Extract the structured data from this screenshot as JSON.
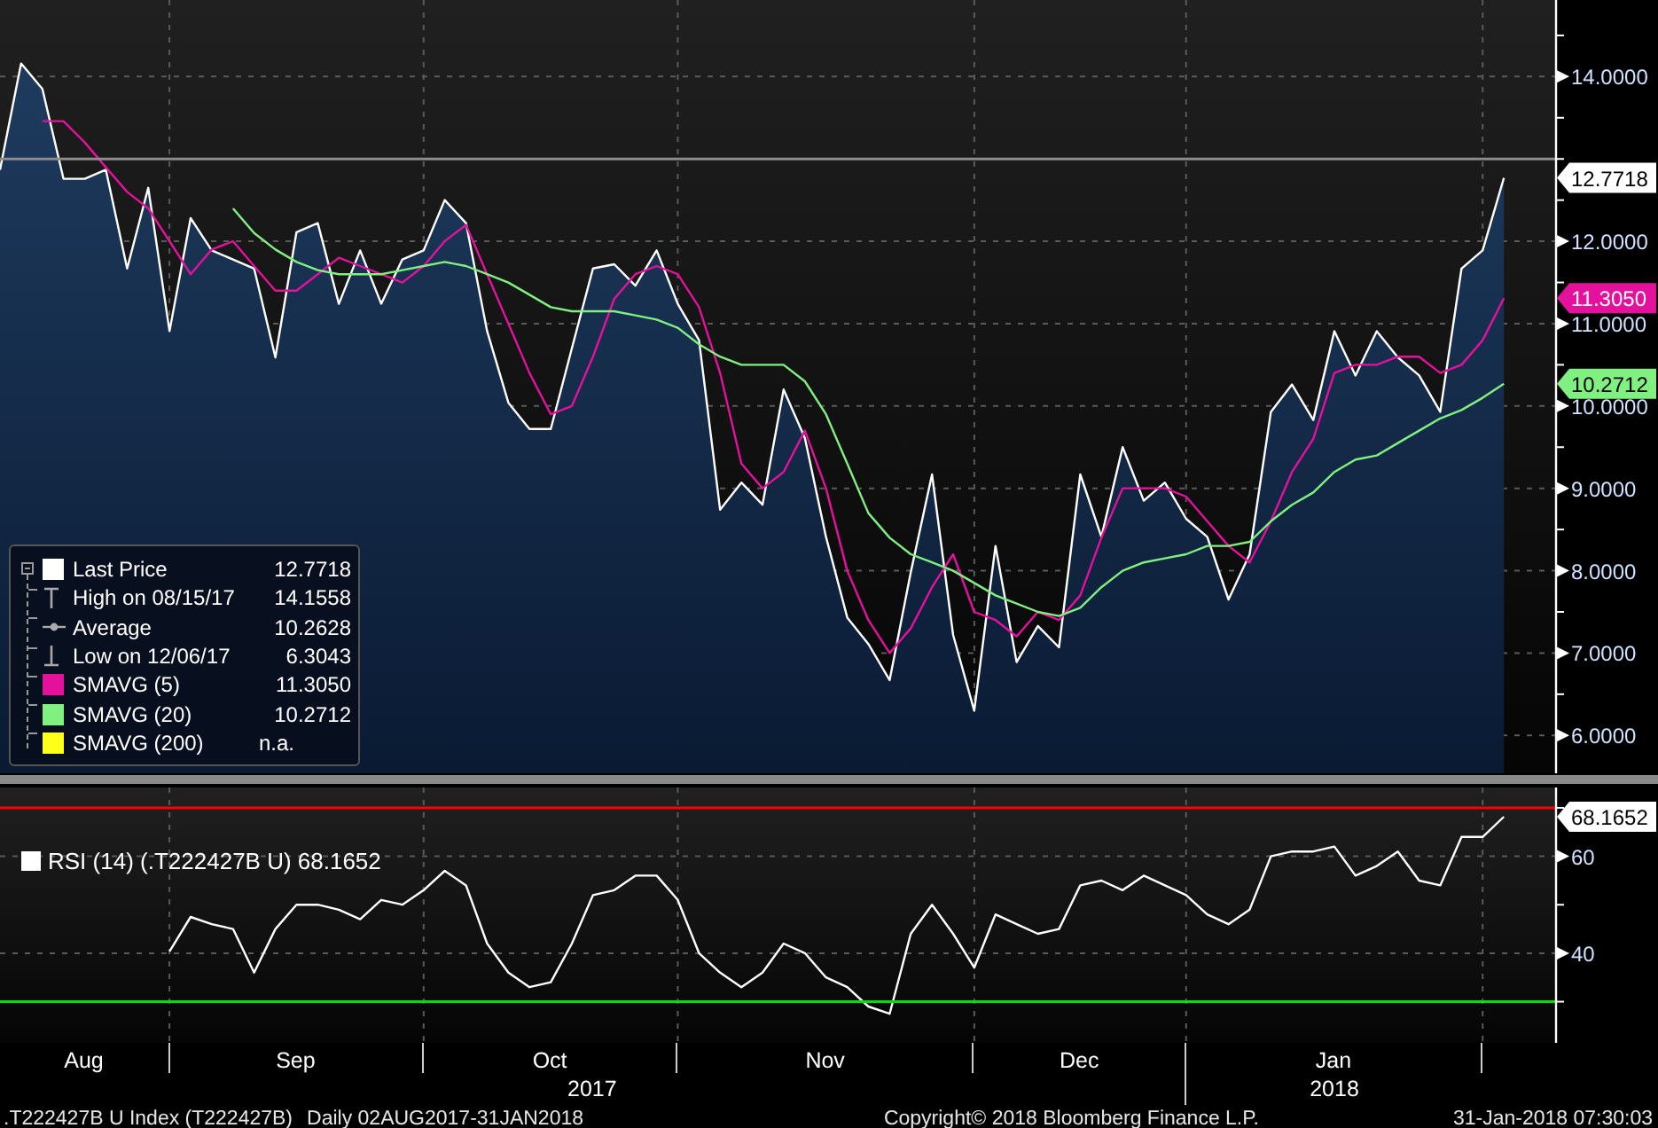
{
  "price_panel": {
    "chart_data": {
      "type": "line",
      "ylim": [
        5.54,
        14.93
      ],
      "grid": true,
      "legend": "lower left",
      "series": [
        {
          "name": "Last Price",
          "color": "#ffffff",
          "type": "area",
          "values": [
            12.87,
            14.16,
            13.85,
            12.76,
            12.76,
            12.87,
            11.67,
            12.65,
            10.91,
            12.28,
            11.89,
            11.78,
            11.67,
            10.59,
            12.11,
            12.22,
            11.24,
            11.89,
            11.24,
            11.78,
            11.89,
            12.5,
            12.22,
            10.91,
            10.04,
            9.72,
            9.72,
            10.7,
            11.67,
            11.72,
            11.46,
            11.89,
            11.24,
            10.8,
            8.74,
            9.07,
            8.8,
            10.2,
            9.61,
            8.41,
            7.43,
            7.11,
            6.67,
            7.98,
            9.17,
            7.22,
            6.3,
            8.3,
            6.89,
            7.33,
            7.07,
            9.17,
            8.41,
            9.5,
            8.85,
            9.07,
            8.63,
            8.41,
            7.65,
            8.2,
            9.93,
            10.26,
            9.83,
            10.91,
            10.37,
            10.91,
            10.59,
            10.37,
            9.93,
            11.67,
            11.89,
            12.77
          ]
        },
        {
          "name": "SMAVG (5)",
          "color": "#e4119c",
          "type": "line",
          "values": [
            null,
            null,
            13.46,
            13.46,
            13.2,
            12.9,
            12.6,
            12.4,
            12.0,
            11.6,
            11.9,
            12.0,
            11.7,
            11.4,
            11.4,
            11.6,
            11.8,
            11.7,
            11.6,
            11.5,
            11.7,
            12.0,
            12.2,
            11.6,
            11.0,
            10.4,
            9.9,
            10.0,
            10.6,
            11.3,
            11.6,
            11.7,
            11.6,
            11.2,
            10.4,
            9.3,
            9.0,
            9.2,
            9.7,
            9.0,
            8.0,
            7.4,
            7.0,
            7.3,
            7.8,
            8.2,
            7.5,
            7.4,
            7.2,
            7.5,
            7.4,
            7.7,
            8.4,
            9.0,
            9.0,
            9.0,
            8.9,
            8.6,
            8.3,
            8.1,
            8.6,
            9.2,
            9.6,
            10.4,
            10.5,
            10.5,
            10.6,
            10.6,
            10.4,
            10.5,
            10.8,
            11.31
          ]
        },
        {
          "name": "SMAVG (20)",
          "color": "#80f080",
          "type": "line",
          "values": [
            null,
            null,
            null,
            null,
            null,
            null,
            null,
            null,
            null,
            null,
            null,
            12.4,
            12.1,
            11.9,
            11.75,
            11.65,
            11.6,
            11.6,
            11.6,
            11.65,
            11.7,
            11.75,
            11.7,
            11.6,
            11.5,
            11.35,
            11.2,
            11.15,
            11.15,
            11.15,
            11.1,
            11.05,
            10.95,
            10.75,
            10.6,
            10.5,
            10.5,
            10.5,
            10.3,
            9.9,
            9.3,
            8.7,
            8.4,
            8.2,
            8.1,
            8.0,
            7.85,
            7.7,
            7.6,
            7.5,
            7.45,
            7.55,
            7.8,
            8.0,
            8.1,
            8.15,
            8.2,
            8.3,
            8.3,
            8.35,
            8.6,
            8.8,
            8.95,
            9.2,
            9.35,
            9.4,
            9.55,
            9.7,
            9.85,
            9.95,
            10.1,
            10.27
          ]
        }
      ],
      "yticks": [
        {
          "value": 6,
          "label": "6.0000"
        },
        {
          "value": 7,
          "label": "7.0000"
        },
        {
          "value": 8,
          "label": "8.0000"
        },
        {
          "value": 9,
          "label": "9.0000"
        },
        {
          "value": 10,
          "label": "10.0000"
        },
        {
          "value": 11,
          "label": "11.0000"
        },
        {
          "value": 12,
          "label": "12.0000"
        },
        {
          "value": 14,
          "label": "14.0000"
        }
      ],
      "ref_lines": [
        {
          "axis": "y",
          "value": 13,
          "color": "#8c8c8c"
        }
      ]
    },
    "tags": [
      {
        "text": "12.7718"
      },
      {
        "text": "11.3050"
      },
      {
        "text": "10.2712"
      }
    ],
    "legend": [
      {
        "kind": "series",
        "value": "12.7718"
      },
      {
        "kind": "high",
        "label": "High on 08/15/17",
        "value": "14.1558"
      },
      {
        "kind": "average",
        "label": "Average",
        "value": "10.2628"
      },
      {
        "kind": "low",
        "label": "Low on 12/06/17",
        "value": "6.3043"
      },
      {
        "kind": "series",
        "value": "11.3050"
      },
      {
        "kind": "series",
        "value": "10.2712"
      },
      {
        "kind": "swatch",
        "label": "SMAVG (200)",
        "value": "n.a.",
        "color": "#ffff1a"
      }
    ]
  },
  "rsi_panel": {
    "chart_data": {
      "type": "line",
      "ylim": [
        21.5,
        74.2
      ],
      "grid": true,
      "categories": [
        null,
        null,
        null,
        null,
        "Aug",
        null,
        null,
        null,
        null,
        null,
        null,
        null,
        null,
        null,
        "Sep",
        null,
        null,
        null,
        null,
        null,
        null,
        null,
        null,
        null,
        null,
        null,
        "Oct",
        null,
        null,
        null,
        null,
        null,
        null,
        null,
        null,
        null,
        null,
        null,
        null,
        "Nov",
        null,
        null,
        null,
        null,
        null,
        null,
        null,
        null,
        null,
        null,
        null,
        "Dec",
        null,
        null,
        null,
        null,
        null,
        null,
        null,
        null,
        null,
        null,
        null,
        "Jan",
        null,
        null,
        null,
        null,
        null,
        null,
        null,
        null
      ],
      "series": [
        {
          "name": "RSI (14)",
          "color": "#ffffff",
          "values": [
            null,
            null,
            null,
            null,
            null,
            null,
            null,
            null,
            40.4,
            47.5,
            46,
            45,
            36,
            45,
            50,
            50,
            49,
            47,
            51,
            50,
            53,
            57,
            54,
            42,
            36,
            33,
            34,
            42,
            52,
            53,
            56,
            56,
            51,
            40,
            36,
            33,
            36,
            42,
            40,
            35,
            33,
            29,
            27.5,
            44,
            50,
            44,
            37,
            48,
            46,
            44,
            45,
            54,
            55,
            53,
            56,
            54,
            52,
            48,
            46,
            49,
            60,
            61,
            61,
            62,
            56,
            58,
            61,
            55,
            54,
            64,
            64,
            68.17
          ]
        }
      ],
      "yticks": [
        {
          "value": 40,
          "label": "40"
        },
        {
          "value": 60,
          "label": "60"
        }
      ],
      "ref_lines": [
        {
          "axis": "y",
          "value": 70,
          "color": "#ff0000"
        },
        {
          "axis": "y",
          "value": 30,
          "color": "#00e000"
        }
      ],
      "annotations": [
        "2017",
        "2018"
      ]
    },
    "tags": [
      {
        "text": "68.1652"
      }
    ],
    "legend": {
      "label": "(.T222427B U) 68.1652"
    }
  },
  "status_bar": {
    "security": ".T222427B U Index (T222427B)",
    "range": "Daily 02AUG2017-31JAN2018",
    "copyright": "Copyright© 2018 Bloomberg Finance L.P.",
    "timestamp": "31-Jan-2018 07:30:03"
  }
}
